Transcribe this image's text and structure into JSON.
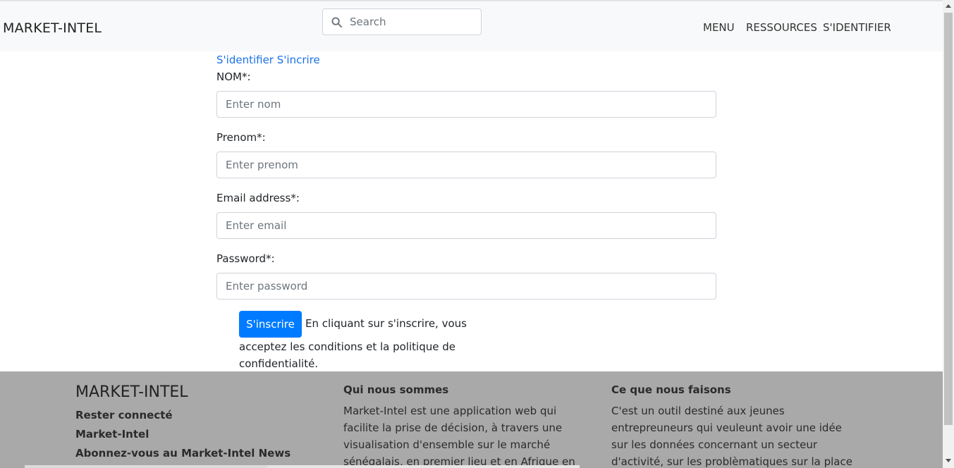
{
  "header": {
    "brand": "MARKET-INTEL",
    "search_placeholder": "Search",
    "nav": [
      "MENU",
      "RESSOURCES",
      "S'IDENTIFIER"
    ]
  },
  "auth": {
    "login_link": "S'identifier",
    "signup_link": "S'incrire"
  },
  "form": {
    "fields": [
      {
        "label": "NOM*:",
        "placeholder": "Enter nom"
      },
      {
        "label": "Prenom*:",
        "placeholder": "Enter prenom"
      },
      {
        "label": "Email address*:",
        "placeholder": "Enter email"
      },
      {
        "label": "Password*:",
        "placeholder": "Enter password"
      }
    ],
    "submit_label": "S'inscrire",
    "terms_1": "En cliquant sur s'inscrire, vous",
    "terms_2": "acceptez les conditions et la politique de",
    "terms_3": "confidentialité."
  },
  "footer": {
    "title": "MARKET-INTEL",
    "links": [
      "Rester connecté",
      "Market-Intel",
      "Abonnez-vous au Market-Intel News"
    ],
    "about_heading": "Qui nous sommes",
    "about_text": "Market-Intel est une application web qui facilite la prise de décision, à travers une visualisation d'ensemble sur le marché sénégalais, en premier lieu et en Afrique en général",
    "what_heading": "Ce que nous faisons",
    "what_text": "C'est un outil destiné aux jeunes entrepreuneurs qui veuleunt avoir une idée sur les données concernant un secteur d'activité, sur les problèmatiques sur la place d'un marcé dans un"
  },
  "colors": {
    "primary": "#007bff",
    "link": "#1a73e8",
    "footer_bg": "#a9a9a9",
    "navbar_bg": "#f8f9fa"
  }
}
